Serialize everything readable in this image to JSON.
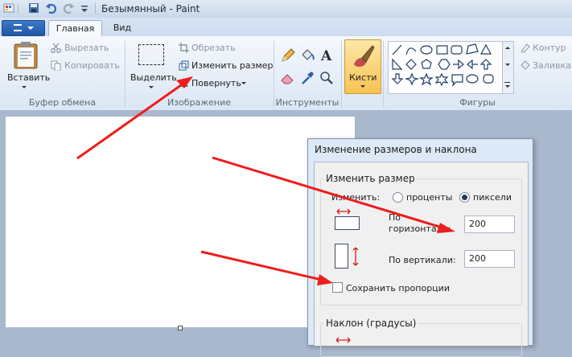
{
  "window": {
    "title": "Безымянный - Paint"
  },
  "tabs": [
    {
      "label": "Главная"
    },
    {
      "label": "Вид"
    }
  ],
  "ribbon": {
    "clipboard": {
      "paste": "Вставить",
      "cut": "Вырезать",
      "copy": "Копировать",
      "group": "Буфер обмена"
    },
    "image": {
      "select": "Выделить",
      "crop": "Обрезать",
      "resize": "Изменить размер",
      "rotate": "Повернуть",
      "group": "Изображение"
    },
    "tools": {
      "group": "Инструменты"
    },
    "brushes": {
      "label": "Кисти"
    },
    "shapes": {
      "group": "Фигуры",
      "outline": "Контур",
      "fill": "Заливка"
    }
  },
  "dialog": {
    "title": "Изменение размеров и наклона",
    "resize_section": "Изменить размер",
    "by_label": "Изменить:",
    "option_percent": "проценты",
    "option_pixels": "пиксели",
    "horizontal_line1": "По",
    "horizontal_line2": "горизонтали:",
    "horizontal_value": "200",
    "vertical_label": "По вертикали:",
    "vertical_value": "200",
    "keep_ratio": "Сохранить пропорции",
    "skew_section": "Наклон (градусы)"
  },
  "colors": {
    "arrow": "#ee1c1c",
    "accent": "#2e6bc6"
  }
}
